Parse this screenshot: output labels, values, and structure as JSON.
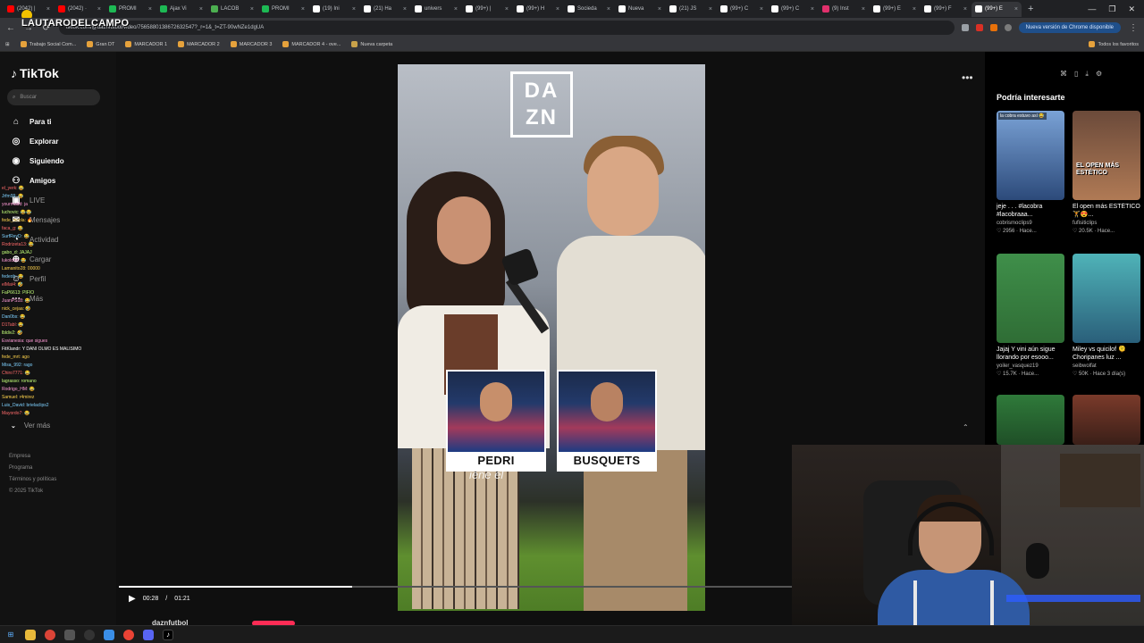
{
  "browser": {
    "tabs": [
      {
        "title": "(2042) |",
        "color": "#ff0000"
      },
      {
        "title": "(2042) ·",
        "color": "#ff0000"
      },
      {
        "title": "PROMI",
        "color": "#1db954"
      },
      {
        "title": "Ajax Vi",
        "color": "#1db954"
      },
      {
        "title": "LACOB",
        "color": "#4caf50"
      },
      {
        "title": "PROMI",
        "color": "#1db954"
      },
      {
        "title": "(19) Ini",
        "color": "#ffffff"
      },
      {
        "title": "(21) Ha",
        "color": "#ffffff"
      },
      {
        "title": "univers",
        "color": "#ffffff"
      },
      {
        "title": "(99+) |",
        "color": "#ffffff"
      },
      {
        "title": "(99+) H",
        "color": "#ffffff"
      },
      {
        "title": "Socieda",
        "color": "#ffffff"
      },
      {
        "title": "Nueva",
        "color": "#ffffff"
      },
      {
        "title": "(21) JS",
        "color": "#ffffff"
      },
      {
        "title": "(99+) C",
        "color": "#ffffff"
      },
      {
        "title": "(99+) C",
        "color": "#ffffff"
      },
      {
        "title": "(9) Inst",
        "color": "#e1306c"
      },
      {
        "title": "(99+) E",
        "color": "#ffffff"
      },
      {
        "title": "(99+) F",
        "color": "#ffffff"
      },
      {
        "title": "(99+) E",
        "color": "#ffffff"
      }
    ],
    "new_tab": "+",
    "window_controls": [
      "—",
      "❐",
      "✕"
    ],
    "url": "tiktok.com/@daznfutbol/video/7565880138672632547?_r=1&_t=ZT-90wNZe1dgUA",
    "update_label": "Nueva versión de Chrome disponible",
    "bookmarks": [
      "Trabajo Social Com...",
      "Gran DT",
      "MARCADOR 1",
      "MARCADOR 2",
      "MARCADOR 3",
      "MARCADOR 4 - ove...",
      "Nueva carpeta"
    ],
    "bookmarks_right": "Todos los favoritos"
  },
  "streamer": {
    "name": "LAUTARODELCAMPO"
  },
  "sidebar": {
    "logo": "TikTok",
    "search_placeholder": "Buscar",
    "nav": [
      {
        "label": "Para ti",
        "icon": "home-icon"
      },
      {
        "label": "Explorar",
        "icon": "compass-icon"
      },
      {
        "label": "Siguiendo",
        "icon": "following-icon"
      },
      {
        "label": "Amigos",
        "icon": "friends-icon"
      },
      {
        "label": "LIVE",
        "icon": "live-icon"
      },
      {
        "label": "Mensajes",
        "icon": "message-icon"
      },
      {
        "label": "Actividad",
        "icon": "activity-icon"
      },
      {
        "label": "Cargar",
        "icon": "upload-icon"
      },
      {
        "label": "Perfil",
        "icon": "profile-icon"
      },
      {
        "label": "Más",
        "icon": "more-icon"
      }
    ],
    "see_more": "Ver más",
    "footer": [
      "Empresa",
      "Programa",
      "Términos y políticas",
      "© 2025 TikTok"
    ]
  },
  "chat": [
    {
      "text": "el_yerk: 😂",
      "color": "#ff6b6b"
    },
    {
      "text": "Jrfm99: 😂",
      "color": "#7fd1ff"
    },
    {
      "text": "yourmadd: ja",
      "color": "#ff9bd6"
    },
    {
      "text": "luchovic: 😂😂",
      "color": "#c4ff7a"
    },
    {
      "text": "fede_nicola: 🔥",
      "color": "#ffd34d"
    },
    {
      "text": "faca_g: 😂",
      "color": "#ff6b6b"
    },
    {
      "text": "SurfReyD: 😂",
      "color": "#7fd1ff"
    },
    {
      "text": "Rodrizeta13: 😂",
      "color": "#ff6b6b"
    },
    {
      "text": "gabo_d: JAJAJ",
      "color": "#c4ff7a"
    },
    {
      "text": "lukoldon: 😂",
      "color": "#ff9bd6"
    },
    {
      "text": "Lamanito28: 00000",
      "color": "#ffd34d"
    },
    {
      "text": "fedeoh: 😂",
      "color": "#7fd1ff"
    },
    {
      "text": "elMat4: 🤣",
      "color": "#ff6b6b"
    },
    {
      "text": "FaP6613: PIFIO",
      "color": "#c4ff7a"
    },
    {
      "text": "JuanPS18: 😂",
      "color": "#ff9bd6"
    },
    {
      "text": "nick_cejaa: 🤣",
      "color": "#ffd34d"
    },
    {
      "text": "Dan0bs: 😂",
      "color": "#7fd1ff"
    },
    {
      "text": "D1Tabl: 😂",
      "color": "#ff6b6b"
    },
    {
      "text": "lbldiv2: 🤣",
      "color": "#c4ff7a"
    },
    {
      "text": "Esvianesia: que sigues",
      "color": "#ff9bd6"
    },
    {
      "text": "FitKlandr: Y DANI OLMO ES MALISIMO",
      "color": "#ffffff"
    },
    {
      "text": "fede_mrt: ago",
      "color": "#ffd34d"
    },
    {
      "text": "Misa_992: rago",
      "color": "#7fd1ff"
    },
    {
      "text": "Chiro7771: 😂",
      "color": "#ff6b6b"
    },
    {
      "text": "lagrasso: romano",
      "color": "#c4ff7a"
    },
    {
      "text": "Rodrigo_HM: 😂",
      "color": "#ff9bd6"
    },
    {
      "text": "Samuel: r4mirez",
      "color": "#ffd34d"
    },
    {
      "text": "Luis_David: brielaclips2",
      "color": "#7fd1ff"
    },
    {
      "text": "Mayordo7: 😂",
      "color": "#ff6b6b"
    }
  ],
  "video": {
    "brand_logo": "DA ZN",
    "player_cards": [
      "PEDRI",
      "BUSQUETS"
    ],
    "caption_fragment": "iene el",
    "time_current": "00:28",
    "time_total": "01:21",
    "progress": 0.346,
    "author": "daznfutbol"
  },
  "recommendations": {
    "title": "Podría interesarte",
    "items": [
      {
        "tag": "la cobra estuvo así 😂",
        "overlay": "",
        "caption": "jeje . . . #lacobra #lacobraaa...",
        "user": "cobrismoclips9",
        "stats": "♡ 2956 · Hace...",
        "color_top": "#7aa2d6",
        "color_bottom": "#2c4a7a"
      },
      {
        "tag": "",
        "overlay": "EL OPEN MÁS ESTÉTICO",
        "caption": "El open más ESTÉTICO 🏋️😍...",
        "user": "fufisiticlips",
        "stats": "♡ 20.5K · Hace...",
        "color_top": "#6b4a3a",
        "color_bottom": "#b07a55"
      },
      {
        "tag": "",
        "overlay": "",
        "caption": "Jajaj Y vini aún sigue llorando por esooo...",
        "user": "yoiler_vasquez19",
        "stats": "♡ 15.7K · Hace...",
        "color_top": "#3f8f4a",
        "color_bottom": "#2f6d35"
      },
      {
        "tag": "",
        "overlay": "",
        "caption": "Miley vs quicilof 🫠 Choripanes luz ...",
        "user": "seibwolfat",
        "stats": "♡ 50K · Hace 3 día(s)",
        "color_top": "#4fb3b8",
        "color_bottom": "#2a5f7a"
      },
      {
        "tag": "",
        "overlay": "",
        "caption": "",
        "user": "",
        "stats": "",
        "color_top": "#2f7a3a",
        "color_bottom": "#1f4f27"
      },
      {
        "tag": "",
        "overlay": "",
        "caption": "",
        "user": "",
        "stats": "",
        "color_top": "#7a3a2a",
        "color_bottom": "#3a1f18"
      }
    ]
  },
  "colors": {
    "tiktok_red": "#fe2c55",
    "dark_bg": "#121212",
    "chrome_dark": "#202124"
  }
}
